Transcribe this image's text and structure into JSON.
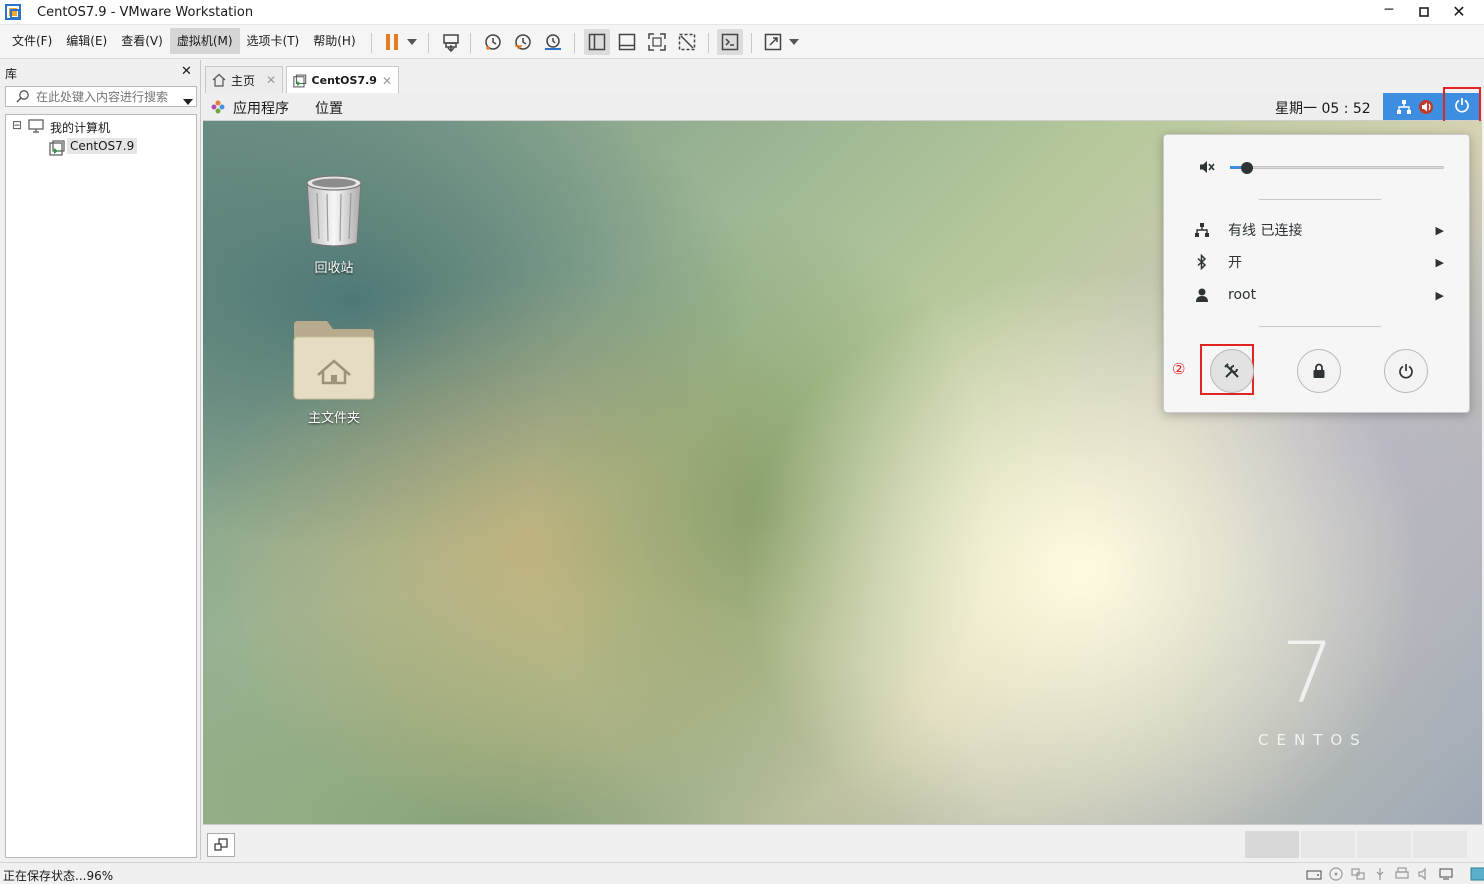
{
  "window": {
    "title": "CentOS7.9  - VMware Workstation",
    "controls": [
      "minimize",
      "maximize",
      "close"
    ]
  },
  "menubar": {
    "items": [
      "文件(F)",
      "编辑(E)",
      "查看(V)",
      "虚拟机(M)",
      "选项卡(T)",
      "帮助(H)"
    ],
    "active_index": 3
  },
  "toolbar": {
    "icons": [
      "pause-icon",
      "dropdown-icon",
      "send-ctrl-alt-del-icon",
      "snapshot-icon",
      "revert-snapshot-icon",
      "snapshot-manager-icon",
      "show-library-icon",
      "thumbnail-bar-icon",
      "fullscreen-icon",
      "unity-icon",
      "console-view-icon",
      "stretch-guest-icon",
      "dropdown-icon"
    ],
    "accent": "#e67e22"
  },
  "library": {
    "title": "库",
    "close": "✕",
    "search_placeholder": "在此处键入内容进行搜索",
    "tree_root": "我的计算机",
    "tree_child": "CentOS7.9",
    "expander": "⊟"
  },
  "tabs": [
    {
      "label": "主页",
      "icon": "home-icon"
    },
    {
      "label": "CentOS7.9",
      "icon": "vm-icon",
      "selected": true
    }
  ],
  "gnome": {
    "apps_menu": "应用程序",
    "places_menu": "位置",
    "clock": "星期一 05 : 52",
    "accent": "#3d8ee0"
  },
  "desktop": {
    "icons": [
      {
        "label": "回收站",
        "icon": "trash-icon"
      },
      {
        "label": "主文件夹",
        "icon": "home-folder-icon"
      }
    ],
    "watermark_number": "7",
    "watermark_text": "CENTOS"
  },
  "popup": {
    "volume_level": 0.05,
    "network": {
      "label": "有线  已连接",
      "icon": "network-icon"
    },
    "bluetooth": {
      "label": "开",
      "icon": "bluetooth-icon"
    },
    "user": {
      "label": "root",
      "icon": "user-icon"
    },
    "arrow": "▶",
    "step_marker": "②",
    "highlight_color": "#e02424",
    "buttons": [
      "settings-icon",
      "lock-icon",
      "power-icon"
    ]
  },
  "statusbar": {
    "text": "正在保存状态...96%"
  }
}
